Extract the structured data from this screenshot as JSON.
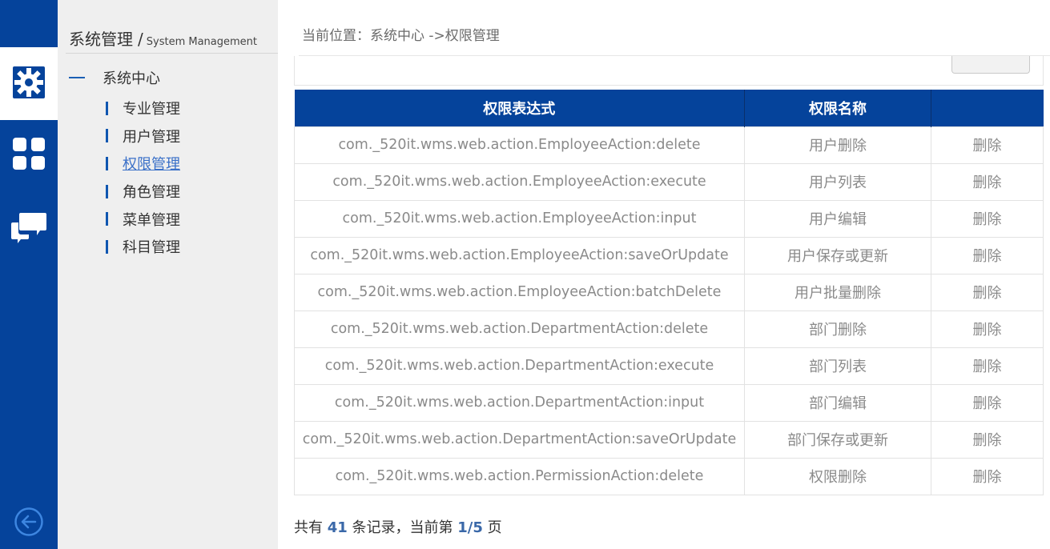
{
  "rail": {
    "items": [
      {
        "icon": "gear-icon",
        "active": true
      },
      {
        "icon": "apps-grid-icon",
        "active": false
      },
      {
        "icon": "chat-bubbles-icon",
        "active": false
      }
    ],
    "back_icon": "back-arrow-icon",
    "bg_color": "#05439b"
  },
  "sidebar": {
    "title_cn": "系统管理",
    "separator": "/",
    "title_en": "System Management",
    "group_label": "系统中心",
    "items": [
      {
        "label": "专业管理",
        "active": false
      },
      {
        "label": "用户管理",
        "active": false
      },
      {
        "label": "权限管理",
        "active": true
      },
      {
        "label": "角色管理",
        "active": false
      },
      {
        "label": "菜单管理",
        "active": false
      },
      {
        "label": "科目管理",
        "active": false
      }
    ]
  },
  "breadcrumb": {
    "text": "当前位置：系统中心 ->权限管理"
  },
  "table": {
    "headers": [
      "权限表达式",
      "权限名称",
      ""
    ],
    "rows": [
      {
        "expression": "com._520it.wms.web.action.EmployeeAction:delete",
        "name": "用户删除",
        "action": "删除"
      },
      {
        "expression": "com._520it.wms.web.action.EmployeeAction:execute",
        "name": "用户列表",
        "action": "删除"
      },
      {
        "expression": "com._520it.wms.web.action.EmployeeAction:input",
        "name": "用户编辑",
        "action": "删除"
      },
      {
        "expression": "com._520it.wms.web.action.EmployeeAction:saveOrUpdate",
        "name": "用户保存或更新",
        "action": "删除"
      },
      {
        "expression": "com._520it.wms.web.action.EmployeeAction:batchDelete",
        "name": "用户批量删除",
        "action": "删除"
      },
      {
        "expression": "com._520it.wms.web.action.DepartmentAction:delete",
        "name": "部门删除",
        "action": "删除"
      },
      {
        "expression": "com._520it.wms.web.action.DepartmentAction:execute",
        "name": "部门列表",
        "action": "删除"
      },
      {
        "expression": "com._520it.wms.web.action.DepartmentAction:input",
        "name": "部门编辑",
        "action": "删除"
      },
      {
        "expression": "com._520it.wms.web.action.DepartmentAction:saveOrUpdate",
        "name": "部门保存或更新",
        "action": "删除"
      },
      {
        "expression": "com._520it.wms.web.action.PermissionAction:delete",
        "name": "权限删除",
        "action": "删除"
      }
    ]
  },
  "pager": {
    "prefix": "共有",
    "total": "41",
    "middle": "条记录，当前第",
    "page": "1/5",
    "suffix": "页"
  }
}
